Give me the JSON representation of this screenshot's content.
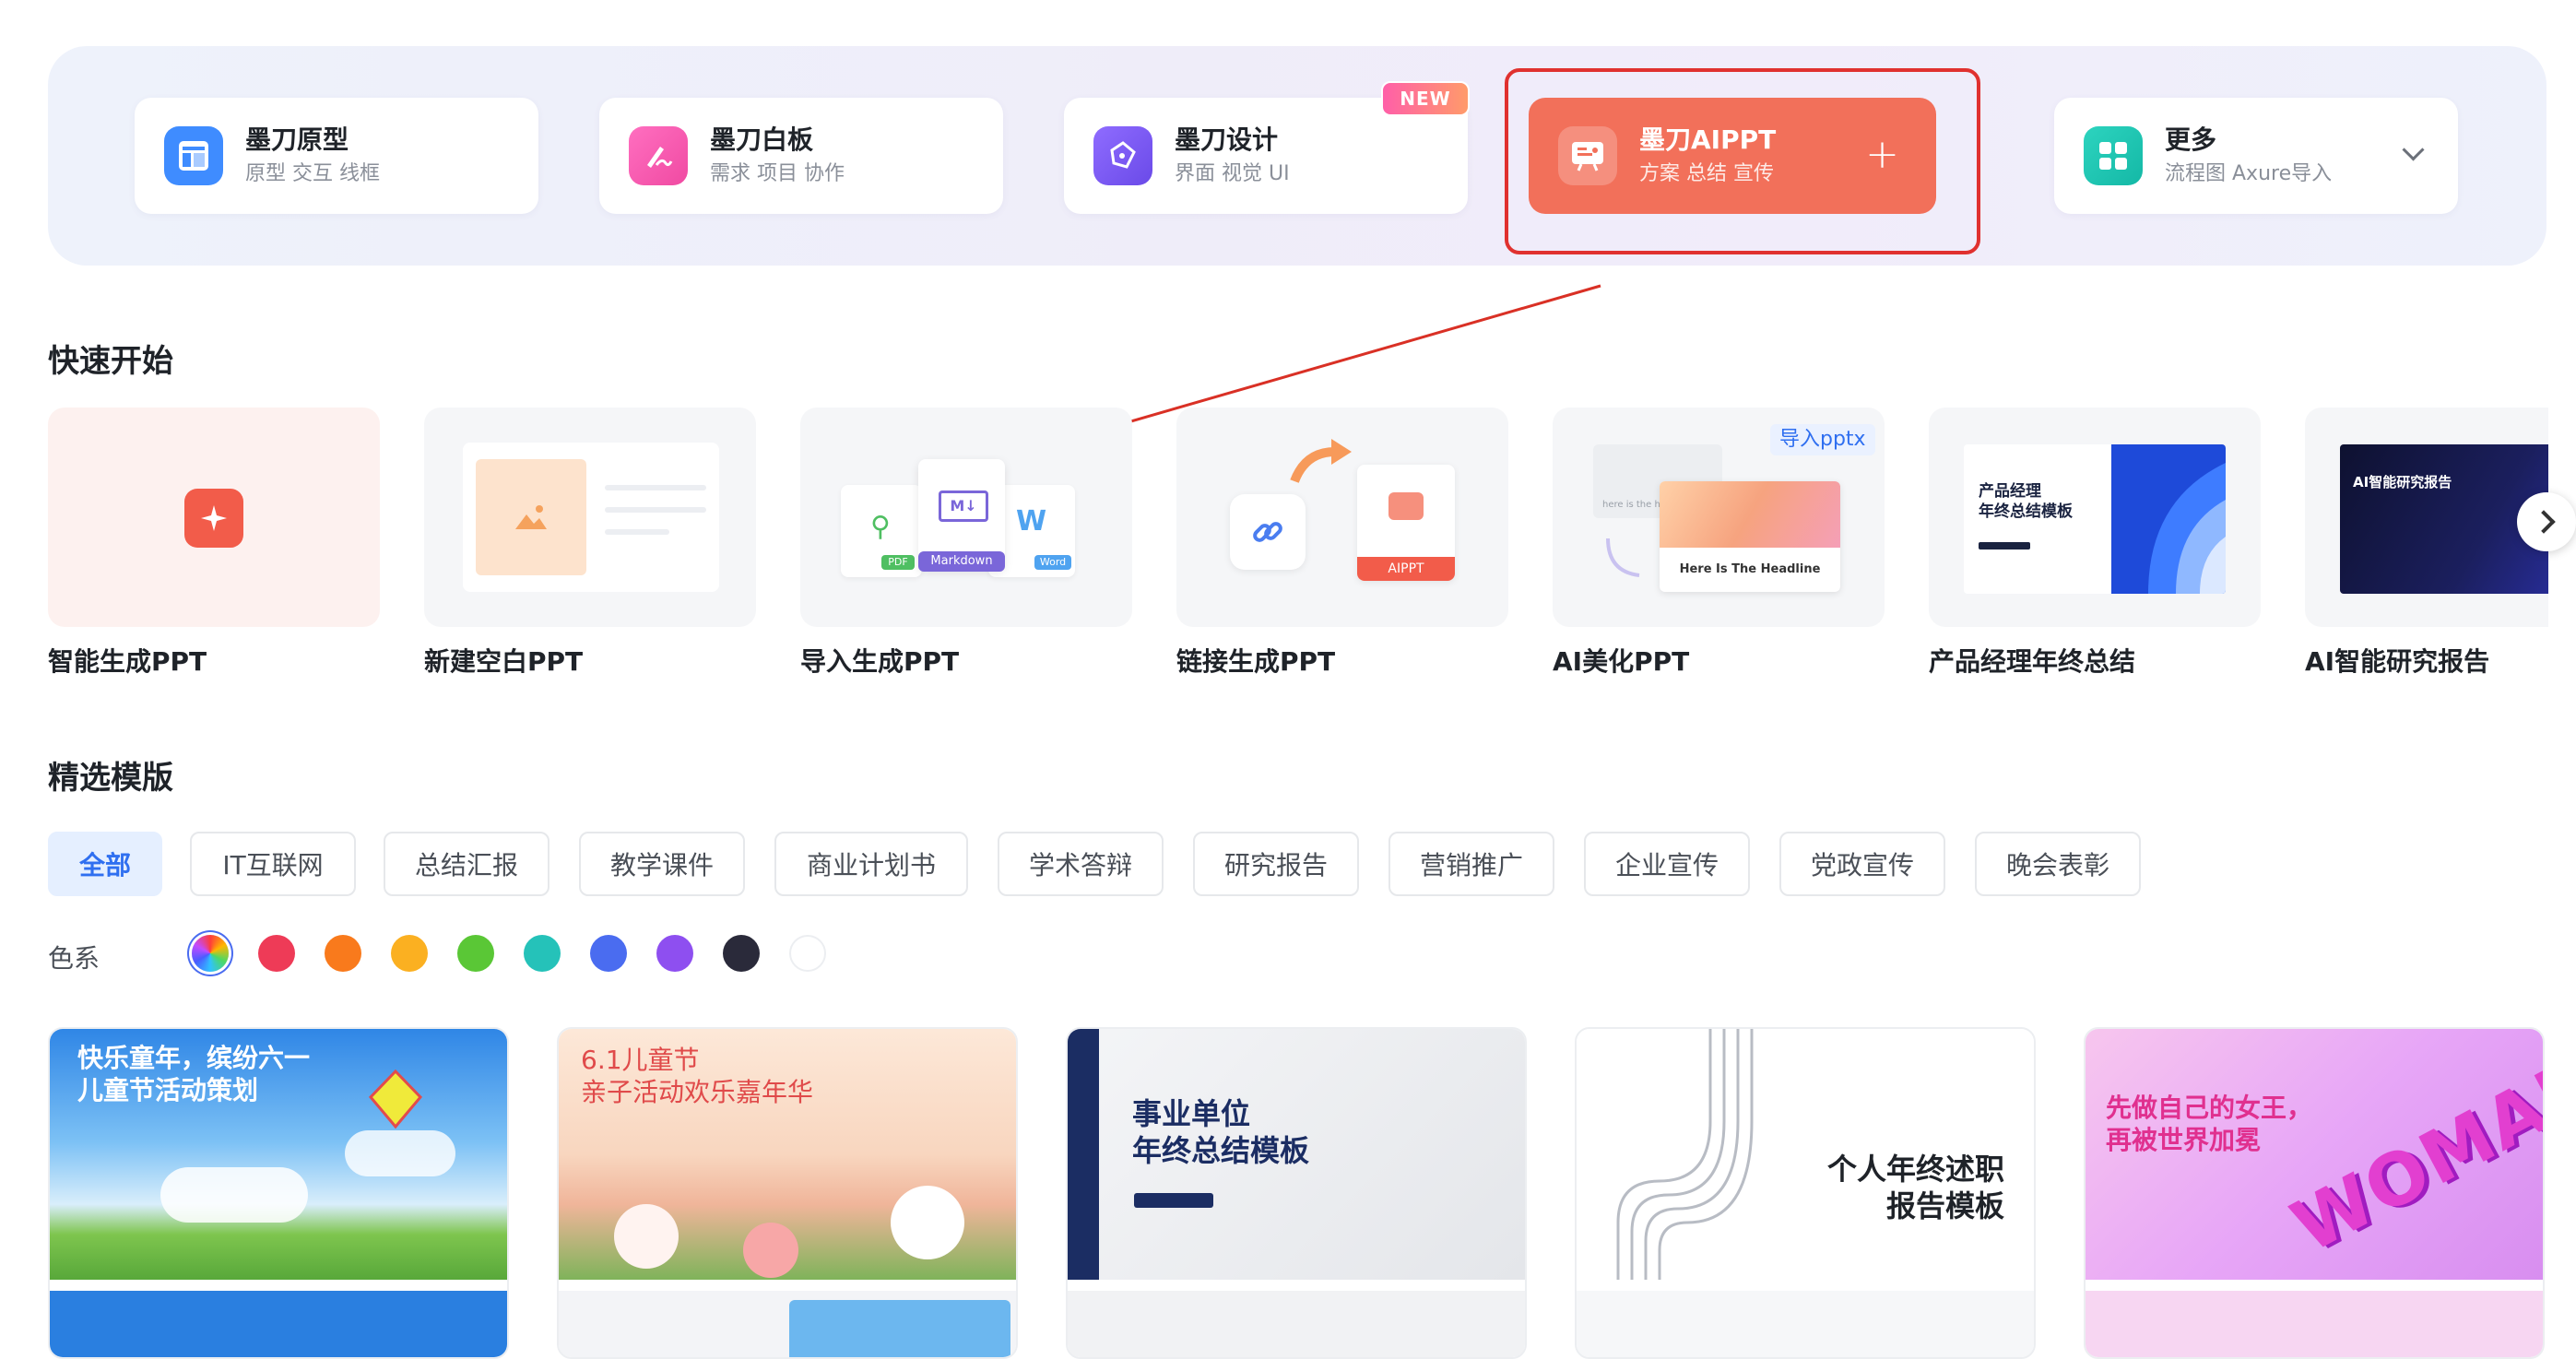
{
  "products": [
    {
      "title": "墨刀原型",
      "subtitle": "原型 交互 线框",
      "icon": "prototype-icon",
      "color": "#3f8cff"
    },
    {
      "title": "墨刀白板",
      "subtitle": "需求 项目 协作",
      "icon": "whiteboard-icon",
      "color": "#f557b4"
    },
    {
      "title": "墨刀设计",
      "subtitle": "界面 视觉 UI",
      "icon": "design-pen-icon",
      "color": "#7a5cf0"
    },
    {
      "title": "墨刀AIPPT",
      "subtitle": "方案 总结 宣传",
      "icon": "aippt-icon",
      "color": "#f2705a"
    },
    {
      "title": "更多",
      "subtitle": "流程图 Axure导入",
      "icon": "grid-icon",
      "color": "#1dc6b0"
    }
  ],
  "new_badge": "NEW",
  "quick_start": {
    "title": "快速开始",
    "items": [
      {
        "label": "智能生成PPT"
      },
      {
        "label": "新建空白PPT"
      },
      {
        "label": "导入生成PPT",
        "tags": {
          "pdf": "PDF",
          "md": "Markdown",
          "word": "Word",
          "md_short": "M↓",
          "w": "W"
        }
      },
      {
        "label": "链接生成PPT",
        "tag": "AIPPT"
      },
      {
        "label": "AI美化PPT",
        "tag": "导入pptx",
        "preview_text": "Here Is The Headline",
        "preview_small": "here is the hea"
      },
      {
        "label": "产品经理年终总结",
        "preview_title": "产品经理\n年终总结模板"
      },
      {
        "label": "AI智能研究报告",
        "preview_title": "AI智能研究报告"
      }
    ]
  },
  "templates_section": {
    "title": "精选模版",
    "categories": [
      "全部",
      "IT互联网",
      "总结汇报",
      "教学课件",
      "商业计划书",
      "学术答辩",
      "研究报告",
      "营销推广",
      "企业宣传",
      "党政宣传",
      "晚会表彰"
    ],
    "active_category": "全部",
    "color_label": "色系",
    "colors": [
      "rainbow",
      "#ee3b57",
      "#f97a1c",
      "#fbb021",
      "#5ac736",
      "#25c2b9",
      "#4a6cf0",
      "#8e4ff0",
      "#2a2a3a",
      "#ffffff"
    ]
  },
  "templates": [
    {
      "title": "快乐童年，缤纷六一\n儿童节活动策划",
      "theme": "#3d8de8"
    },
    {
      "title": "6.1儿童节\n亲子活动欢乐嘉年华",
      "theme": "#f4c7a1"
    },
    {
      "title": "事业单位\n年终总结模板",
      "theme": "#1b2d63"
    },
    {
      "title": "个人年终述职\n报告模板",
      "theme": "#ffffff"
    },
    {
      "title": "先做自己的女王，\n再被世界加冕",
      "theme": "#d85bf0",
      "art_text": "WOMAN"
    }
  ]
}
